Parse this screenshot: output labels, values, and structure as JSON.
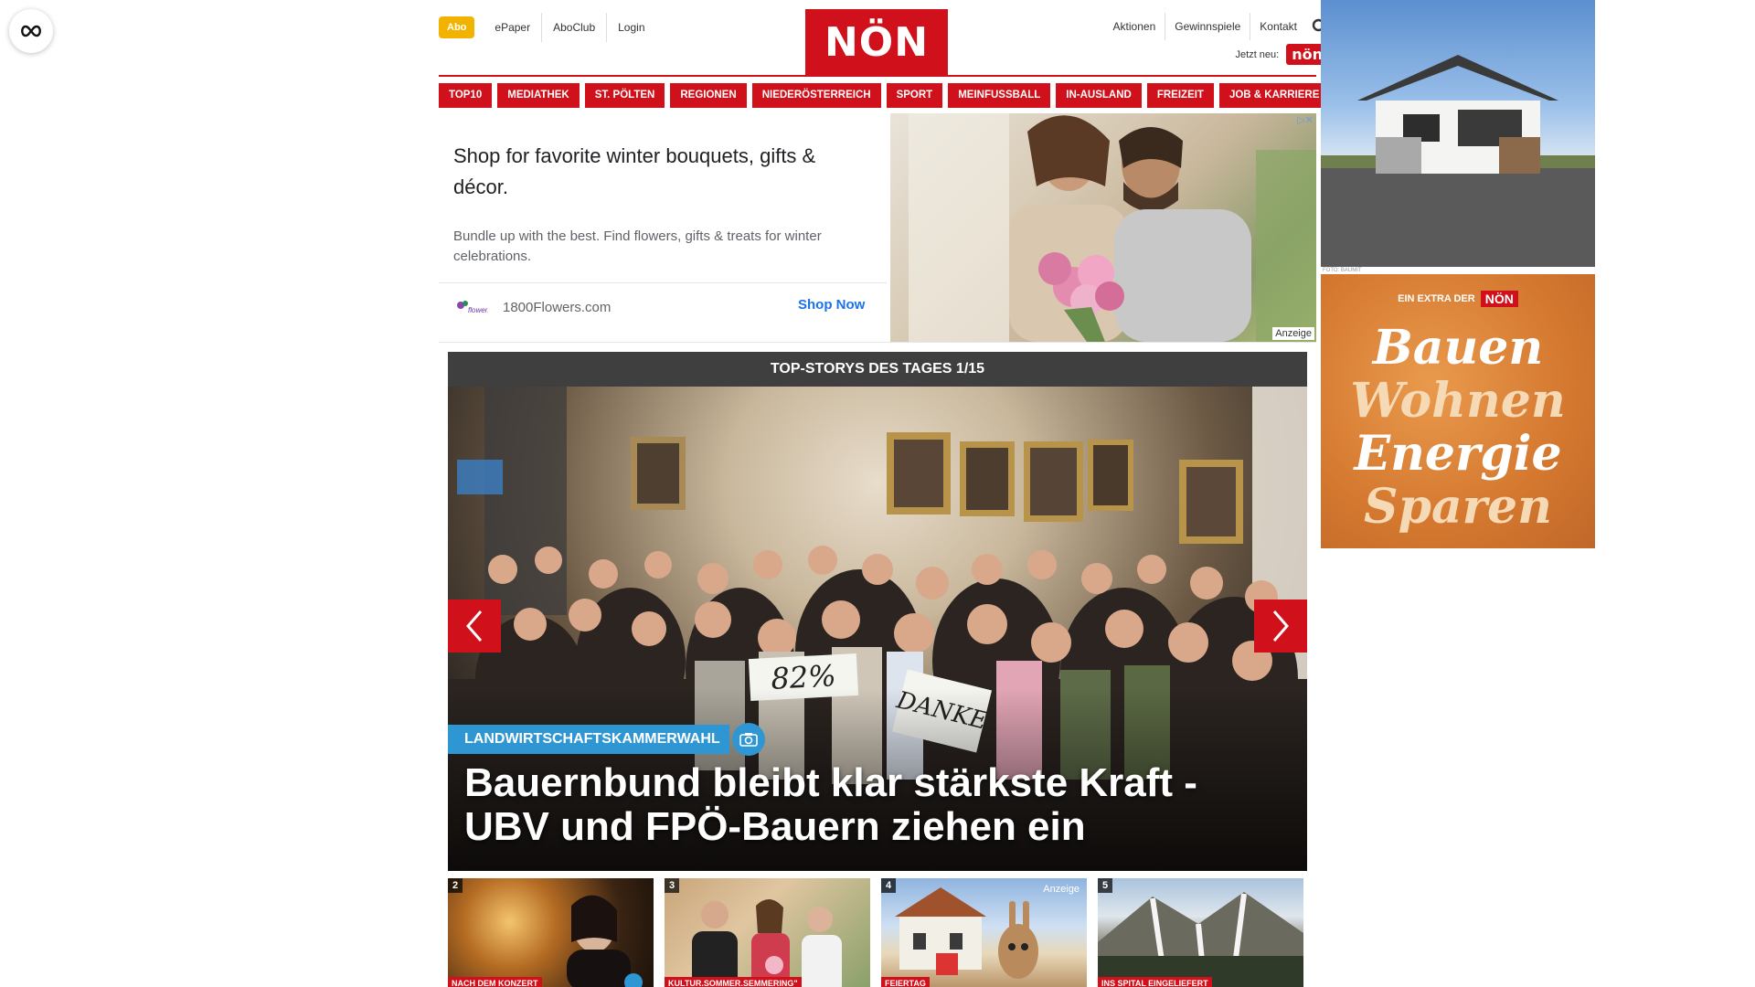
{
  "header": {
    "abo_label": "Abo",
    "left_links": [
      "ePaper",
      "AboClub",
      "Login"
    ],
    "logo_text": "NÖN",
    "right_links": [
      "Aktionen",
      "Gewinnspiele",
      "Kontakt"
    ],
    "jetzt_neu": "Jetzt neu:",
    "jetzt_badge": "nön"
  },
  "nav": [
    "TOP10",
    "MEDIATHEK",
    "ST. PÖLTEN",
    "REGIONEN",
    "NIEDERÖSTERREICH",
    "SPORT",
    "MEINFUSSBALL",
    "IN-AUSLAND",
    "FREIZEIT",
    "JOB & KARRIERE"
  ],
  "ad": {
    "title": "Shop for favorite winter bouquets, gifts & décor.",
    "description": "Bundle up with the best. Find flowers, gifts & treats for winter celebrations.",
    "brand": "1800Flowers.com",
    "cta": "Shop Now",
    "badge": "▷✕",
    "anzeige": "Anzeige"
  },
  "top_stories": {
    "header": "TOP-STORYS DES TAGES 1/15",
    "tag": "LANDWIRTSCHAFTSKAMMERWAHL",
    "headline": "Bauernbund bleibt klar stärkste Kraft - UBV und FPÖ-Bauern ziehen ein",
    "sign_left": "82%",
    "sign_right": "DANKE"
  },
  "thumbs": [
    {
      "num": "2",
      "tag": "NACH DEM KONZERT",
      "anzeige": ""
    },
    {
      "num": "3",
      "tag": "KULTUR.SOMMER.SEMMERING\"",
      "anzeige": ""
    },
    {
      "num": "4",
      "tag": "FEIERTAG",
      "anzeige": "Anzeige"
    },
    {
      "num": "5",
      "tag": "INS SPITAL EINGELIEFERT",
      "anzeige": ""
    }
  ],
  "sidebar": {
    "credit": "FOTO: BAUMIT",
    "extra_label": "EIN EXTRA DER",
    "extra_logo": "NÖN",
    "words": [
      "Bauen",
      "Wohnen",
      "Energie",
      "Sparen"
    ]
  },
  "colors": {
    "brand_red": "#d0101a",
    "abo_yellow": "#f2b300",
    "tag_blue": "#2f96d4",
    "stories_bar": "#3f3f3f"
  }
}
